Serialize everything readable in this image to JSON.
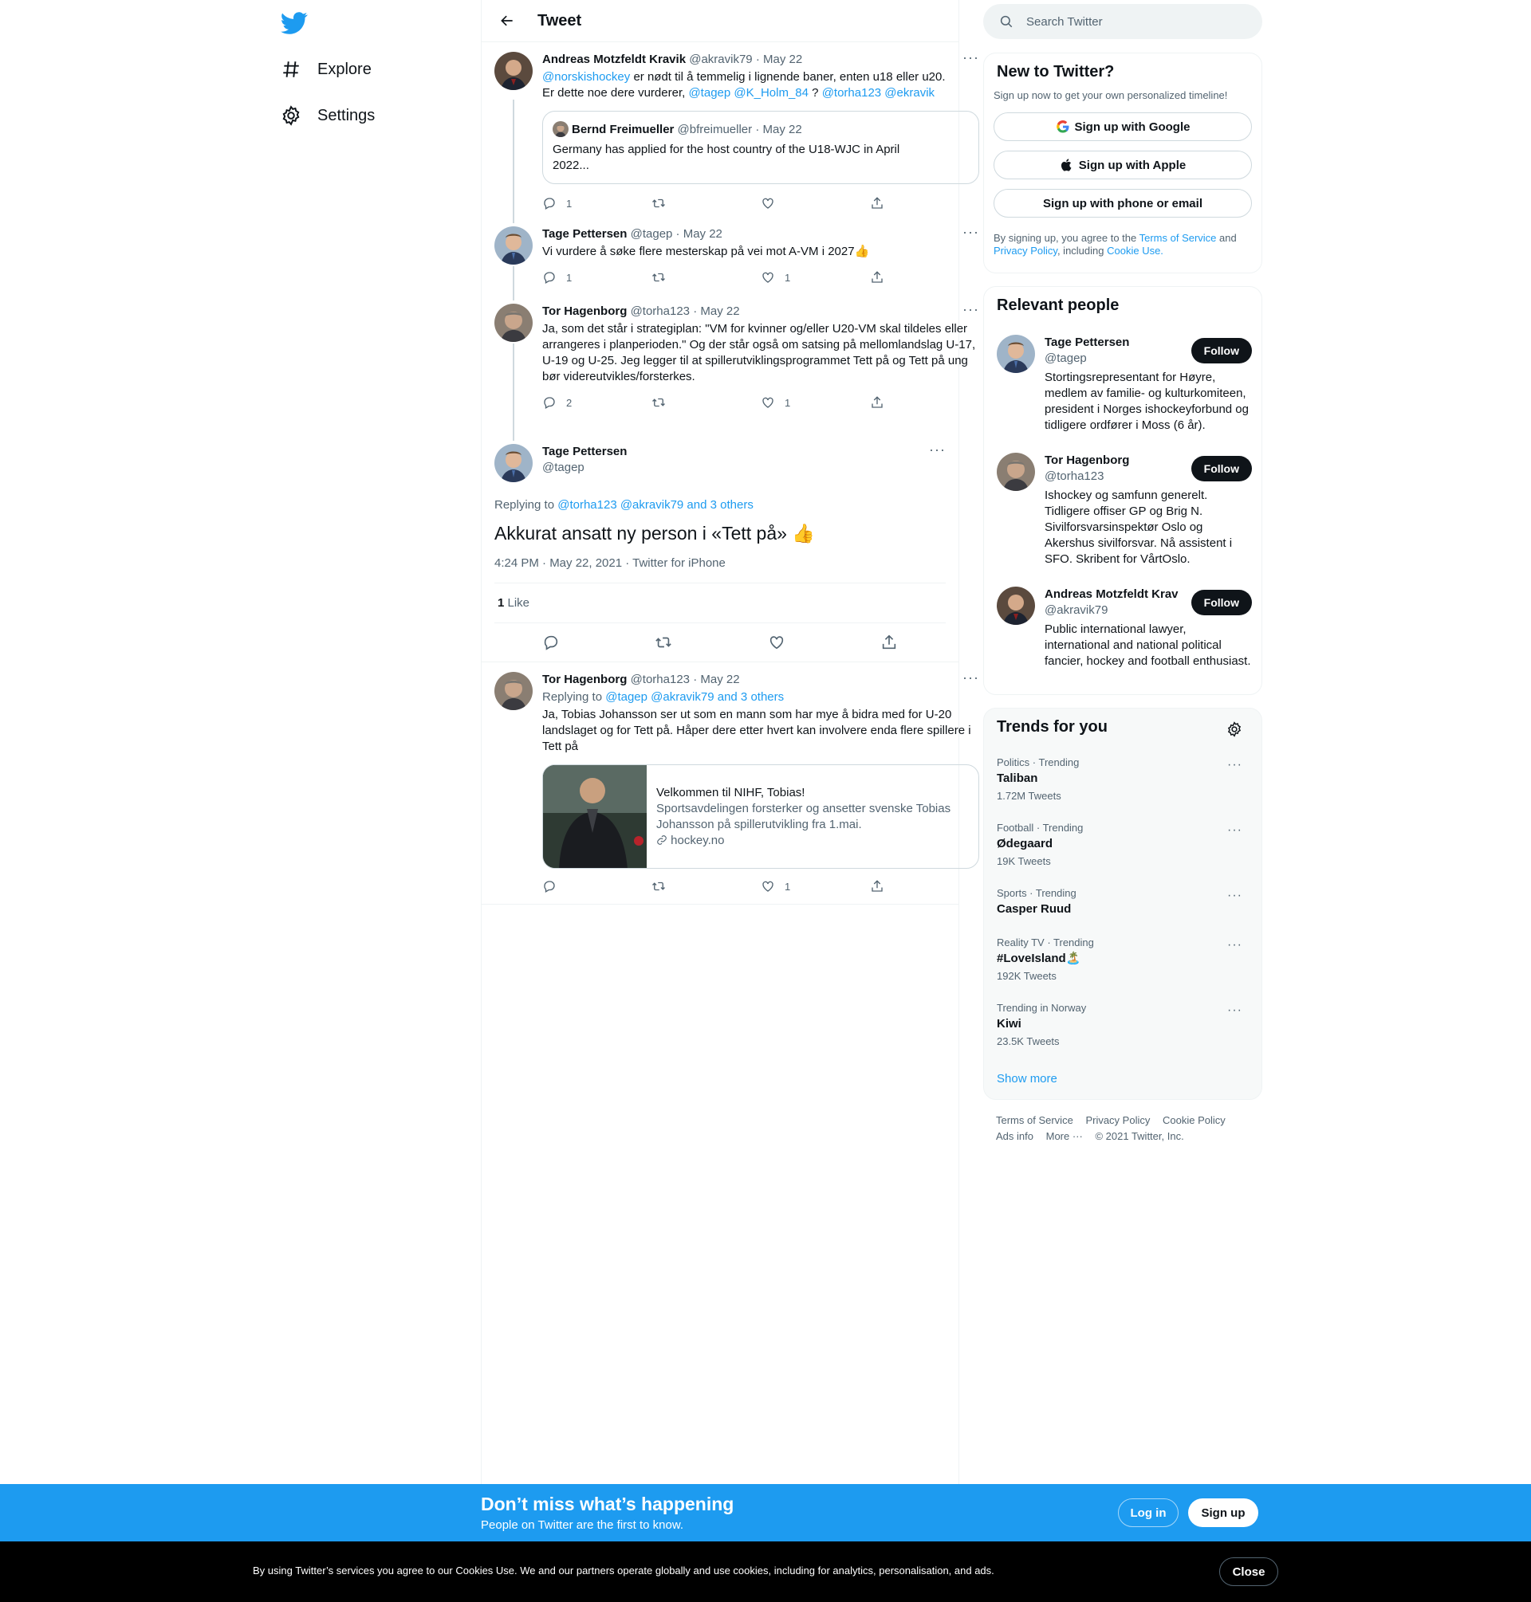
{
  "nav": {
    "explore": "Explore",
    "settings": "Settings"
  },
  "header": {
    "title": "Tweet"
  },
  "thread": [
    {
      "name": "Andreas Motzfeldt Kravik",
      "handle": "@akravik79",
      "date": "· May 22",
      "mention1": "@norskishockey",
      "text1": " er nødt til å temmelig i lignende baner, enten u18 eller u20.",
      "text2": "Er dette noe dere vurderer, ",
      "mention2": "@tagep @K_Holm_84",
      "text3": " ? ",
      "mention3": "@torha123 @ekravik",
      "replies": "1",
      "likes": "",
      "quote": {
        "name": "Bernd Freimueller",
        "handle": "@bfreimueller",
        "date": "· May 22",
        "text": "Germany has applied for the host country of the U18-WJC in April 2022..."
      }
    },
    {
      "name": "Tage Pettersen",
      "handle": "@tagep",
      "date": "· May 22",
      "text": "Vi vurdere å søke flere mesterskap på vei mot A-VM i 2027👍",
      "replies": "1",
      "likes": "1"
    },
    {
      "name": "Tor Hagenborg",
      "handle": "@torha123",
      "date": "· May 22",
      "text": "Ja, som det står i strategiplan: \"VM for kvinner og/eller U20-VM skal tildeles eller arrangeres i planperioden.\" Og der står også om satsing på mellomlandslag U-17, U-19 og U-25. Jeg legger til at spillerutviklingsprogrammet Tett på og Tett på ung bør videreutvikles/forsterkes.",
      "replies": "2",
      "likes": "1"
    }
  ],
  "focus": {
    "name": "Tage Pettersen",
    "handle": "@tagep",
    "replying_label": "Replying to ",
    "replying_to": "@torha123 @akravik79 and 3 others",
    "text": "Akkurat ansatt ny person i «Tett på» 👍",
    "meta": "4:24 PM · May 22, 2021 · Twitter for iPhone",
    "like_count": "1",
    "like_label": " Like"
  },
  "reply": {
    "name": "Tor Hagenborg",
    "handle": "@torha123",
    "date": "· May 22",
    "replying_label": "Replying to ",
    "replying_to": "@tagep @akravik79 and 3 others",
    "text": "Ja, Tobias Johansson ser ut som en mann som har mye å bidra med for U-20 landslaget og for Tett på. Håper dere etter hvert kan involvere enda flere spillere i Tett på",
    "likes": "1",
    "card": {
      "title": "Velkommen til NIHF, Tobias!",
      "desc": "Sportsavdelingen forsterker og ansetter svenske Tobias Johansson på spillerutvikling fra 1.mai.",
      "domain": "hockey.no"
    }
  },
  "search": {
    "placeholder": "Search Twitter"
  },
  "new_to_twitter": {
    "title": "New to Twitter?",
    "subtitle": "Sign up now to get your own personalized timeline!",
    "google": "Sign up with Google",
    "apple": "Sign up with Apple",
    "email": "Sign up with phone or email",
    "legal1": "By signing up, you agree to the ",
    "tos": "Terms of Service",
    "legal2": " and ",
    "privacy": "Privacy Policy",
    "legal3": ", including ",
    "cookie": "Cookie Use."
  },
  "relevant": {
    "title": "Relevant people",
    "follow": "Follow",
    "people": [
      {
        "name": "Tage Pettersen",
        "handle": "@tagep",
        "bio": "Stortingsrepresentant for Høyre, medlem av familie- og kulturkomiteen, president i Norges ishockeyforbund og tidligere ordfører i Moss (6 år)."
      },
      {
        "name": "Tor Hagenborg",
        "handle": "@torha123",
        "bio": "Ishockey og samfunn generelt. Tidligere offiser GP og Brig N. Sivilforsvarsinspektør Oslo og Akershus sivilforsvar. Nå assistent i SFO. Skribent for VårtOslo."
      },
      {
        "name": "Andreas Motzfeldt Krav",
        "handle": "@akravik79",
        "bio": "Public international lawyer, international and national political fancier, hockey and football enthusiast."
      }
    ]
  },
  "trends": {
    "title": "Trends for you",
    "items": [
      {
        "meta": "Politics · Trending",
        "name": "Taliban",
        "count": "1.72M Tweets"
      },
      {
        "meta": "Football · Trending",
        "name": "Ødegaard",
        "count": "19K Tweets"
      },
      {
        "meta": "Sports · Trending",
        "name": "Casper Ruud",
        "count": ""
      },
      {
        "meta": "Reality TV · Trending",
        "name": "#LoveIsland🏝️",
        "count": "192K Tweets"
      },
      {
        "meta": "Trending in Norway",
        "name": "Kiwi",
        "count": "23.5K Tweets"
      }
    ],
    "show_more": "Show more"
  },
  "footer": {
    "tos": "Terms of Service",
    "privacy": "Privacy Policy",
    "cookie": "Cookie Policy",
    "ads": "Ads info",
    "more": "More ···",
    "copy": "© 2021 Twitter, Inc."
  },
  "banner": {
    "title": "Don’t miss what’s happening",
    "subtitle": "People on Twitter are the first to know.",
    "login": "Log in",
    "signup": "Sign up"
  },
  "cookie_bar": {
    "text": "By using Twitter’s services you agree to our Cookies Use. We and our partners operate globally and use cookies, including for analytics, personalisation, and ads.",
    "close": "Close"
  },
  "colors": {
    "accent": "#1d9bf0",
    "text": "#0f1419",
    "muted": "#536471"
  }
}
